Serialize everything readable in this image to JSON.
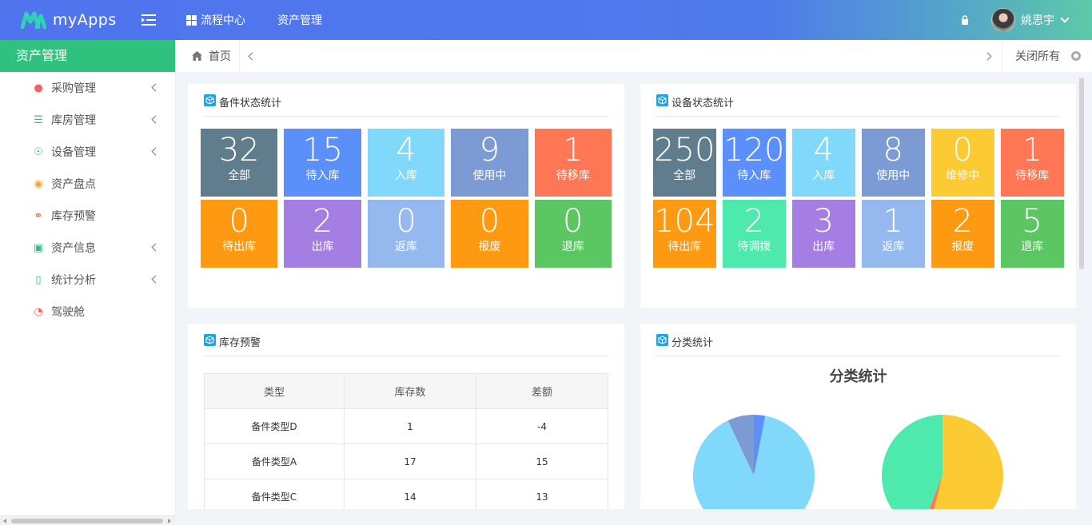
{
  "app": {
    "name": "myApps",
    "user": "姚思宇"
  },
  "topnav": [
    {
      "label": "流程中心"
    },
    {
      "label": "资产管理"
    }
  ],
  "sidebar": {
    "title": "资产管理",
    "items": [
      {
        "label": "采购管理",
        "icon": "money-bag-icon",
        "color": "#f0645b",
        "expandable": true
      },
      {
        "label": "库房管理",
        "icon": "stack-icon",
        "color": "#2ec27e",
        "expandable": true
      },
      {
        "label": "设备管理",
        "icon": "signal-icon",
        "color": "#2ec27e",
        "expandable": true
      },
      {
        "label": "资产盘点",
        "icon": "coins-icon",
        "color": "#f5a623",
        "expandable": false
      },
      {
        "label": "库存预警",
        "icon": "headset-icon",
        "color": "#f0645b",
        "expandable": false
      },
      {
        "label": "资产信息",
        "icon": "briefcase-icon",
        "color": "#2ec27e",
        "expandable": true
      },
      {
        "label": "统计分析",
        "icon": "bar-chart-icon",
        "color": "#2ec27e",
        "expandable": true
      },
      {
        "label": "驾驶舱",
        "icon": "pie-icon",
        "color": "#f0645b",
        "expandable": false
      }
    ]
  },
  "tabs": {
    "home": "首页",
    "close_all": "关闭所有"
  },
  "spare_parts": {
    "title": "备件状态统计",
    "tiles": [
      {
        "value": "32",
        "label": "全部",
        "color": "#5f7d8c"
      },
      {
        "value": "15",
        "label": "待入库",
        "color": "#5b8ff9"
      },
      {
        "value": "4",
        "label": "入库",
        "color": "#80d8fa"
      },
      {
        "value": "9",
        "label": "使用中",
        "color": "#7c9bd4"
      },
      {
        "value": "1",
        "label": "待移库",
        "color": "#ff7754"
      },
      {
        "value": "0",
        "label": "待出库",
        "color": "#fd9a12"
      },
      {
        "value": "2",
        "label": "出库",
        "color": "#a57ee3"
      },
      {
        "value": "0",
        "label": "返库",
        "color": "#95b9ef"
      },
      {
        "value": "0",
        "label": "报废",
        "color": "#fd9a12"
      },
      {
        "value": "0",
        "label": "退库",
        "color": "#5cc662"
      }
    ]
  },
  "equipment": {
    "title": "设备状态统计",
    "tiles": [
      {
        "value": "250",
        "label": "全部",
        "color": "#5f7d8c"
      },
      {
        "value": "120",
        "label": "待入库",
        "color": "#5b8ff9"
      },
      {
        "value": "4",
        "label": "入库",
        "color": "#80d8fa"
      },
      {
        "value": "8",
        "label": "使用中",
        "color": "#7c9bd4"
      },
      {
        "value": "0",
        "label": "维修中",
        "color": "#fcca33"
      },
      {
        "value": "1",
        "label": "待移库",
        "color": "#ff7754"
      },
      {
        "value": "104",
        "label": "待出库",
        "color": "#fd9a12"
      },
      {
        "value": "2",
        "label": "待调拨",
        "color": "#4ee9ad"
      },
      {
        "value": "3",
        "label": "出库",
        "color": "#a57ee3"
      },
      {
        "value": "1",
        "label": "返库",
        "color": "#95b9ef"
      },
      {
        "value": "2",
        "label": "报废",
        "color": "#fd9a12"
      },
      {
        "value": "5",
        "label": "退库",
        "color": "#5cc662"
      }
    ]
  },
  "stock_warning": {
    "title": "库存预警",
    "columns": [
      "类型",
      "库存数",
      "差额"
    ],
    "rows": [
      [
        "备件类型D",
        "1",
        "-4"
      ],
      [
        "备件类型A",
        "17",
        "15"
      ],
      [
        "备件类型C",
        "14",
        "13"
      ]
    ]
  },
  "category": {
    "title": "分类统计",
    "chart_title": "分类统计"
  },
  "chart_data": [
    {
      "type": "pie",
      "title": "分类统计",
      "slices": [
        {
          "value": 3,
          "color": "#5b8ff9"
        },
        {
          "value": 90,
          "color": "#80d8fa"
        },
        {
          "value": 7,
          "color": "#7c9bd4"
        }
      ]
    },
    {
      "type": "pie",
      "slices": [
        {
          "value": 54,
          "color": "#fcca33"
        },
        {
          "value": 2,
          "color": "#ff7754"
        },
        {
          "value": 44,
          "color": "#4ee9ad"
        }
      ]
    }
  ]
}
